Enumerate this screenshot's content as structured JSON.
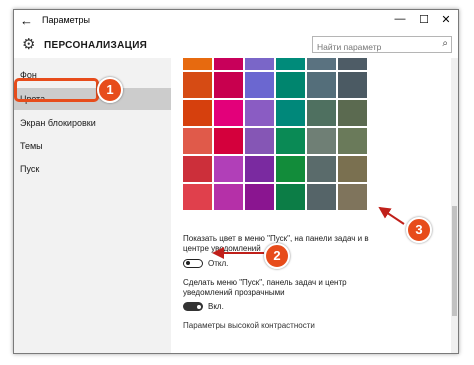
{
  "window": {
    "title": "Параметры",
    "back_glyph": "←",
    "minimize_glyph": "—",
    "maximize_glyph": "☐",
    "close_glyph": "✕"
  },
  "header": {
    "section_title": "ПЕРСОНАЛИЗАЦИЯ",
    "search_placeholder": "Найти параметр",
    "search_value": ""
  },
  "sidebar": {
    "items": [
      {
        "label": "Фон"
      },
      {
        "label": "Цвета",
        "active": true
      },
      {
        "label": "Экран блокировки"
      },
      {
        "label": "Темы"
      },
      {
        "label": "Пуск"
      }
    ]
  },
  "palette": {
    "rows": [
      [
        "#ef7d0f",
        "#e3008c",
        "#0078d7",
        "#00b7c3",
        "#00cc6a",
        "#7a7574"
      ],
      [
        "#ca5010",
        "#bf0077",
        "#6b69d6",
        "#038387",
        "#10893e",
        "#5d5a58"
      ],
      [
        "#da3b01",
        "#c30052",
        "#8e8cd8",
        "#00b294",
        "#107c10",
        "#68768a"
      ],
      [
        "#ef6950",
        "#ea005e",
        "#8764b8",
        "#018574",
        "#767676",
        "#515c6b"
      ],
      [
        "#d13438",
        "#e81123",
        "#744da9",
        "#00cc6a",
        "#4c4a48",
        "#567c73"
      ],
      [
        "#ff4343",
        "#b146c2",
        "#881798",
        "#10893e",
        "#69797e",
        "#7e735f"
      ],
      [
        "#e74856",
        "#c239b3",
        "#9a0089",
        "#0f7b4f",
        "#4a5459",
        "#847545"
      ]
    ],
    "visible_rows": [
      [
        "#e76a0f",
        "#c8005a",
        "#7a66c8",
        "#008b7a",
        "#5a7280",
        "#4e5c66"
      ],
      [
        "#d64b14",
        "#c8004e",
        "#6b67d0",
        "#00856e",
        "#546e7a",
        "#4b5a63"
      ],
      [
        "#d6400d",
        "#e3007a",
        "#8a5cc3",
        "#00887a",
        "#4f7060",
        "#5b6a50"
      ],
      [
        "#e05a4a",
        "#d4003c",
        "#8556b5",
        "#0a8a55",
        "#6f7f75",
        "#6a7a5a"
      ],
      [
        "#cc2f3a",
        "#b13fb8",
        "#7a2aa0",
        "#128c3a",
        "#5a6b6b",
        "#7a7050"
      ],
      [
        "#e0404c",
        "#b530a8",
        "#8a1590",
        "#0c7d46",
        "#556468",
        "#7f745c"
      ]
    ]
  },
  "settings": {
    "start_color_label": "Показать цвет в меню \"Пуск\", на панели задач и в центре уведомлений",
    "start_color_state": "Откл.",
    "transparency_label": "Сделать меню \"Пуск\", панель задач и центр уведомлений прозрачными",
    "transparency_state": "Вкл.",
    "high_contrast_link": "Параметры высокой контрастности"
  },
  "annotations": {
    "callout_1": "1",
    "callout_2": "2",
    "callout_3": "3",
    "accent": "#e74c1b"
  }
}
